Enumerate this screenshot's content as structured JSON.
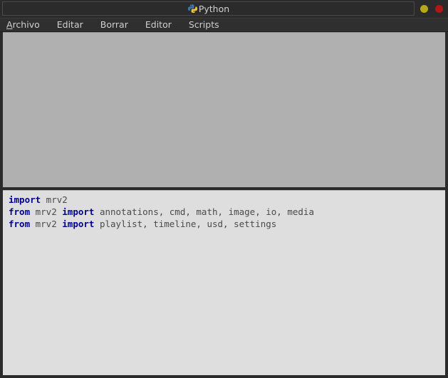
{
  "window": {
    "title": "Python",
    "icon": "python-logo-icon",
    "controls": [
      {
        "name": "minimize-button",
        "icon": "circle-icon",
        "color": "#b8a818"
      },
      {
        "name": "close-button",
        "icon": "circle-icon",
        "color": "#b01818"
      }
    ],
    "colors": {
      "chrome": "#2b2b2b",
      "menubar": "#2f2f2f",
      "title_text": "#d2d2d2",
      "menu_text": "#cfcfcf",
      "output_bg": "#b0b0b0",
      "editor_bg": "#dedede",
      "keyword": "#00008c",
      "code_text": "#4a4a4a"
    }
  },
  "menubar": {
    "items": [
      {
        "label": "Archivo",
        "accel": "A",
        "rest": "rchivo"
      },
      {
        "label": "Editar"
      },
      {
        "label": "Borrar"
      },
      {
        "label": "Editor"
      },
      {
        "label": "Scripts"
      }
    ]
  },
  "output_panel": {
    "name": "python-output-console",
    "content": ""
  },
  "editor_panel": {
    "name": "python-script-editor",
    "lines": [
      [
        {
          "t": "import",
          "k": true
        },
        {
          "t": " mrv2",
          "k": false
        }
      ],
      [
        {
          "t": "from",
          "k": true
        },
        {
          "t": " mrv2 ",
          "k": false
        },
        {
          "t": "import",
          "k": true
        },
        {
          "t": " annotations, cmd, math, image, io, media",
          "k": false
        }
      ],
      [
        {
          "t": "from",
          "k": true
        },
        {
          "t": " mrv2 ",
          "k": false
        },
        {
          "t": "import",
          "k": true
        },
        {
          "t": " playlist, timeline, usd, settings",
          "k": false
        }
      ]
    ],
    "plain_text": "import mrv2\nfrom mrv2 import annotations, cmd, math, image, io, media\nfrom mrv2 import playlist, timeline, usd, settings"
  }
}
